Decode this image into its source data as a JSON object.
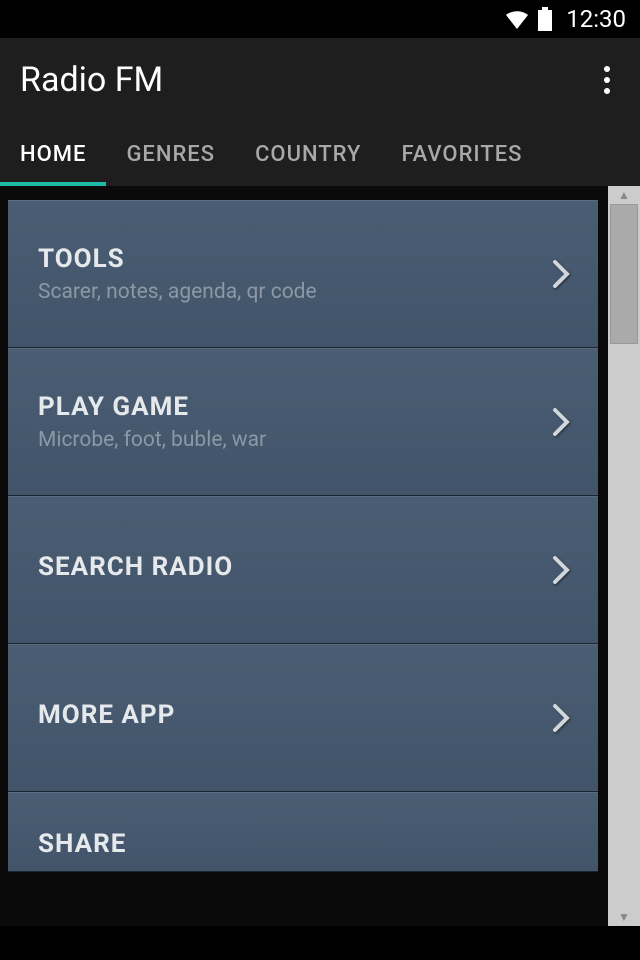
{
  "status": {
    "time": "12:30"
  },
  "app": {
    "title": "Radio FM"
  },
  "tabs": [
    {
      "label": "HOME",
      "active": true
    },
    {
      "label": "GENRES",
      "active": false
    },
    {
      "label": "COUNTRY",
      "active": false
    },
    {
      "label": "FAVORITES",
      "active": false
    }
  ],
  "list": [
    {
      "title": "TOOLS",
      "subtitle": "Scarer, notes, agenda, qr code"
    },
    {
      "title": "PLAY GAME",
      "subtitle": "Microbe, foot, buble, war"
    },
    {
      "title": "SEARCH RADIO",
      "subtitle": ""
    },
    {
      "title": "MORE APP",
      "subtitle": ""
    },
    {
      "title": "SHARE",
      "subtitle": ""
    }
  ]
}
